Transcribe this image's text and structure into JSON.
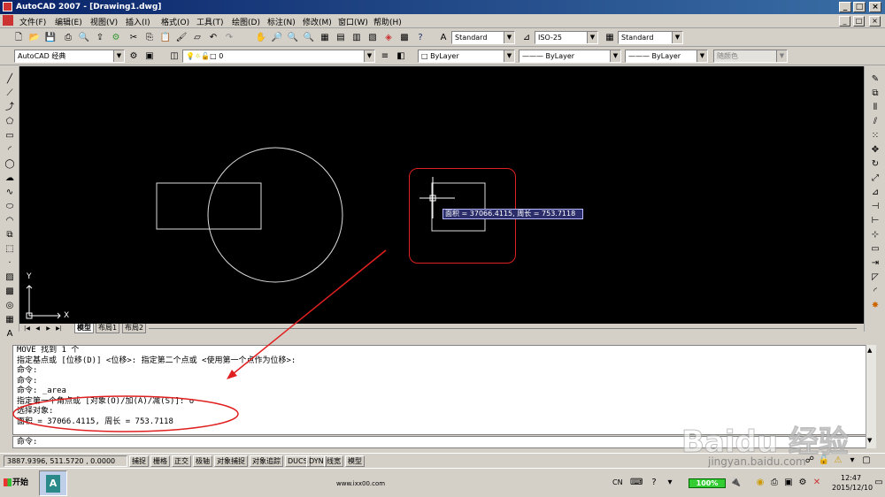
{
  "window": {
    "title": "AutoCAD 2007 - [Drawing1.dwg]",
    "minimize": "_",
    "restore": "□",
    "close": "×"
  },
  "menu": [
    "文件(F)",
    "编辑(E)",
    "视图(V)",
    "插入(I)",
    "格式(O)",
    "工具(T)",
    "绘图(D)",
    "标注(N)",
    "修改(M)",
    "窗口(W)",
    "帮助(H)"
  ],
  "toolbar": {
    "text_style": "Standard",
    "dim_style": "ISO-25",
    "table_style": "Standard",
    "workspace": "AutoCAD 经典",
    "layer": "0",
    "color": "ByLayer",
    "linetype": "ByLayer",
    "lineweight": "ByLayer",
    "plotstyle": "随颜色"
  },
  "canvas": {
    "ucs_x": "X",
    "ucs_y": "Y",
    "tooltip": "面积 = 37066.4115, 周长 = 753.7118",
    "tabs": [
      "模型",
      "布局1",
      "布局2"
    ]
  },
  "command": {
    "history": [
      "MOVE 找到 1 个",
      "指定基点或 [位移(D)] <位移>:  指定第二个点或 <使用第一个点作为位移>:",
      "命令:",
      "命令:",
      "命令:  _area",
      "指定第一个角点或 [对象(O)/加(A)/减(S)]: o",
      "选择对象:",
      "面积 = 37066.4115, 周长 = 753.7118"
    ],
    "prompt": "命令:"
  },
  "status": {
    "coords": "3887.9396, 511.5720 , 0.0000",
    "toggles": [
      "捕捉",
      "栅格",
      "正交",
      "极轴",
      "对象捕捉",
      "对象追踪",
      "DUCS",
      "DYN",
      "线宽",
      "模型"
    ]
  },
  "taskbar": {
    "start": "开始",
    "url": "www.ixx00.com",
    "lang": "CN",
    "battery": "100%",
    "time": "12:47",
    "date": "2015/12/10"
  },
  "watermark": {
    "brand": "Baidu 经验",
    "site": "jingyan.baidu.com"
  },
  "colors": {
    "annotation": "#e02020",
    "tooltip_bg": "#2a2d6a",
    "titlebar": "#0a246a"
  }
}
